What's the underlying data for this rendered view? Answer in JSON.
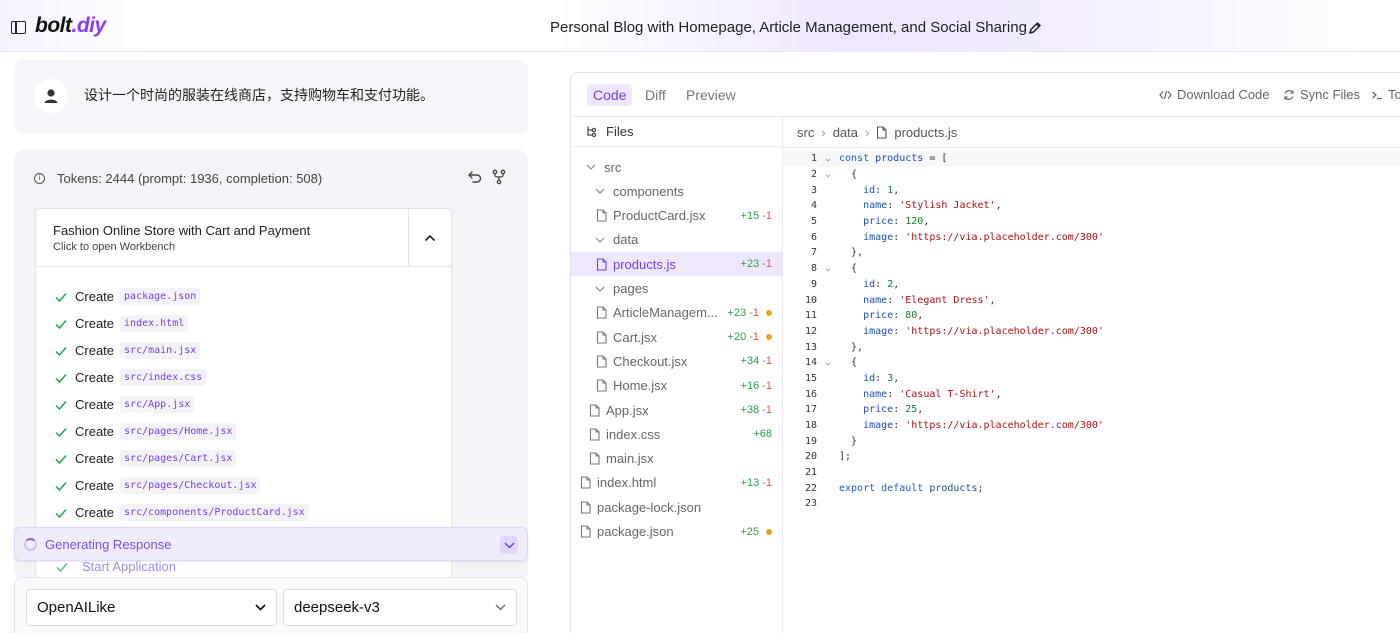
{
  "header": {
    "logo_main": "bolt",
    "logo_accent": ".diy",
    "project_title": "Personal Blog with Homepage, Article Management, and Social Sharing"
  },
  "chat": {
    "user_message": "设计一个时尚的服装在线商店，支持购物车和支付功能。",
    "tokens": "Tokens: 2444 (prompt: 1936, completion: 508)",
    "artifact": {
      "title": "Fashion Online Store with Cart and Payment",
      "subtitle": "Click to open Workbench",
      "actions": [
        {
          "verb": "Create",
          "file": "package.json"
        },
        {
          "verb": "Create",
          "file": "index.html"
        },
        {
          "verb": "Create",
          "file": "src/main.jsx"
        },
        {
          "verb": "Create",
          "file": "src/index.css"
        },
        {
          "verb": "Create",
          "file": "src/App.jsx"
        },
        {
          "verb": "Create",
          "file": "src/pages/Home.jsx"
        },
        {
          "verb": "Create",
          "file": "src/pages/Cart.jsx"
        },
        {
          "verb": "Create",
          "file": "src/pages/Checkout.jsx"
        },
        {
          "verb": "Create",
          "file": "src/components/ProductCard.jsx"
        }
      ],
      "start_application": "Start Application"
    },
    "generating_label": "Generating Response",
    "provider_select": "OpenAILike",
    "model_select": "deepseek-v3"
  },
  "workbench": {
    "tabs": [
      "Code",
      "Diff",
      "Preview"
    ],
    "active_tab": "Code",
    "tools": {
      "download": "Download Code",
      "sync": "Sync Files",
      "terminal": "Toggle Terminal"
    },
    "files_label": "Files",
    "tree": [
      {
        "label": "src",
        "type": "folder",
        "depth": 0,
        "add": "",
        "del": "",
        "dot": false
      },
      {
        "label": "components",
        "type": "folder",
        "depth": 1,
        "add": "",
        "del": "",
        "dot": false
      },
      {
        "label": "ProductCard.jsx",
        "type": "file",
        "depth": 2,
        "add": "+15",
        "del": "-1",
        "dot": false
      },
      {
        "label": "data",
        "type": "folder",
        "depth": 1,
        "add": "",
        "del": "",
        "dot": false
      },
      {
        "label": "products.js",
        "type": "file",
        "depth": 2,
        "add": "+23",
        "del": "-1",
        "dot": false,
        "selected": true
      },
      {
        "label": "pages",
        "type": "folder",
        "depth": 1,
        "add": "",
        "del": "",
        "dot": false
      },
      {
        "label": "ArticleManagem...",
        "type": "file",
        "depth": 2,
        "add": "+23",
        "del": "-1",
        "dot": true
      },
      {
        "label": "Cart.jsx",
        "type": "file",
        "depth": 2,
        "add": "+20",
        "del": "-1",
        "dot": true
      },
      {
        "label": "Checkout.jsx",
        "type": "file",
        "depth": 2,
        "add": "+34",
        "del": "-1",
        "dot": false
      },
      {
        "label": "Home.jsx",
        "type": "file",
        "depth": 2,
        "add": "+16",
        "del": "-1",
        "dot": false
      },
      {
        "label": "App.jsx",
        "type": "file",
        "depth": 1,
        "add": "+38",
        "del": "-1",
        "dot": false
      },
      {
        "label": "index.css",
        "type": "file",
        "depth": 1,
        "add": "+68",
        "del": "",
        "dot": false
      },
      {
        "label": "main.jsx",
        "type": "file",
        "depth": 1,
        "add": "",
        "del": "",
        "dot": false
      },
      {
        "label": "index.html",
        "type": "file",
        "depth": 0,
        "add": "+13",
        "del": "-1",
        "dot": false
      },
      {
        "label": "package-lock.json",
        "type": "file",
        "depth": 0,
        "add": "",
        "del": "",
        "dot": false
      },
      {
        "label": "package.json",
        "type": "file",
        "depth": 0,
        "add": "+25",
        "del": "",
        "dot": true
      }
    ],
    "breadcrumb": [
      "src",
      "data",
      "products.js"
    ],
    "code_lines": [
      {
        "n": "1",
        "fold": true,
        "tokens": [
          [
            "kw",
            "const "
          ],
          [
            "vr",
            "products"
          ],
          [
            "pl",
            " = ["
          ]
        ]
      },
      {
        "n": "2",
        "fold": true,
        "tokens": [
          [
            "pl",
            "  {"
          ]
        ]
      },
      {
        "n": "3",
        "fold": false,
        "tokens": [
          [
            "pl",
            "    "
          ],
          [
            "vr",
            "id"
          ],
          [
            "pl",
            ": "
          ],
          [
            "num",
            "1"
          ],
          [
            "pl",
            ","
          ]
        ]
      },
      {
        "n": "4",
        "fold": false,
        "tokens": [
          [
            "pl",
            "    "
          ],
          [
            "vr",
            "name"
          ],
          [
            "pl",
            ": "
          ],
          [
            "str",
            "'Stylish Jacket'"
          ],
          [
            "pl",
            ","
          ]
        ]
      },
      {
        "n": "5",
        "fold": false,
        "tokens": [
          [
            "pl",
            "    "
          ],
          [
            "vr",
            "price"
          ],
          [
            "pl",
            ": "
          ],
          [
            "num",
            "120"
          ],
          [
            "pl",
            ","
          ]
        ]
      },
      {
        "n": "6",
        "fold": false,
        "tokens": [
          [
            "pl",
            "    "
          ],
          [
            "vr",
            "image"
          ],
          [
            "pl",
            ": "
          ],
          [
            "str",
            "'https://via.placeholder.com/300'"
          ]
        ]
      },
      {
        "n": "7",
        "fold": false,
        "tokens": [
          [
            "pl",
            "  },"
          ]
        ]
      },
      {
        "n": "8",
        "fold": true,
        "tokens": [
          [
            "pl",
            "  {"
          ]
        ]
      },
      {
        "n": "9",
        "fold": false,
        "tokens": [
          [
            "pl",
            "    "
          ],
          [
            "vr",
            "id"
          ],
          [
            "pl",
            ": "
          ],
          [
            "num",
            "2"
          ],
          [
            "pl",
            ","
          ]
        ]
      },
      {
        "n": "10",
        "fold": false,
        "tokens": [
          [
            "pl",
            "    "
          ],
          [
            "vr",
            "name"
          ],
          [
            "pl",
            ": "
          ],
          [
            "str",
            "'Elegant Dress'"
          ],
          [
            "pl",
            ","
          ]
        ]
      },
      {
        "n": "11",
        "fold": false,
        "tokens": [
          [
            "pl",
            "    "
          ],
          [
            "vr",
            "price"
          ],
          [
            "pl",
            ": "
          ],
          [
            "num",
            "80"
          ],
          [
            "pl",
            ","
          ]
        ]
      },
      {
        "n": "12",
        "fold": false,
        "tokens": [
          [
            "pl",
            "    "
          ],
          [
            "vr",
            "image"
          ],
          [
            "pl",
            ": "
          ],
          [
            "str",
            "'https://via.placeholder.com/300'"
          ]
        ]
      },
      {
        "n": "13",
        "fold": false,
        "tokens": [
          [
            "pl",
            "  },"
          ]
        ]
      },
      {
        "n": "14",
        "fold": true,
        "tokens": [
          [
            "pl",
            "  {"
          ]
        ]
      },
      {
        "n": "15",
        "fold": false,
        "tokens": [
          [
            "pl",
            "    "
          ],
          [
            "vr",
            "id"
          ],
          [
            "pl",
            ": "
          ],
          [
            "num",
            "3"
          ],
          [
            "pl",
            ","
          ]
        ]
      },
      {
        "n": "16",
        "fold": false,
        "tokens": [
          [
            "pl",
            "    "
          ],
          [
            "vr",
            "name"
          ],
          [
            "pl",
            ": "
          ],
          [
            "str",
            "'Casual T-Shirt'"
          ],
          [
            "pl",
            ","
          ]
        ]
      },
      {
        "n": "17",
        "fold": false,
        "tokens": [
          [
            "pl",
            "    "
          ],
          [
            "vr",
            "price"
          ],
          [
            "pl",
            ": "
          ],
          [
            "num",
            "25"
          ],
          [
            "pl",
            ","
          ]
        ]
      },
      {
        "n": "18",
        "fold": false,
        "tokens": [
          [
            "pl",
            "    "
          ],
          [
            "vr",
            "image"
          ],
          [
            "pl",
            ": "
          ],
          [
            "str",
            "'https://via.placeholder.com/300'"
          ]
        ]
      },
      {
        "n": "19",
        "fold": false,
        "tokens": [
          [
            "pl",
            "  }"
          ]
        ]
      },
      {
        "n": "20",
        "fold": false,
        "tokens": [
          [
            "pl",
            "];"
          ]
        ]
      },
      {
        "n": "21",
        "fold": false,
        "tokens": []
      },
      {
        "n": "22",
        "fold": false,
        "tokens": [
          [
            "kw",
            "export default "
          ],
          [
            "vr",
            "products"
          ],
          [
            "pl",
            ";"
          ]
        ]
      },
      {
        "n": "23",
        "fold": false,
        "tokens": []
      }
    ]
  },
  "colors": {
    "accent": "#8b3df5",
    "added": "#2f9d4f",
    "removed": "#d9534f",
    "modified_dot": "#f0a020"
  }
}
